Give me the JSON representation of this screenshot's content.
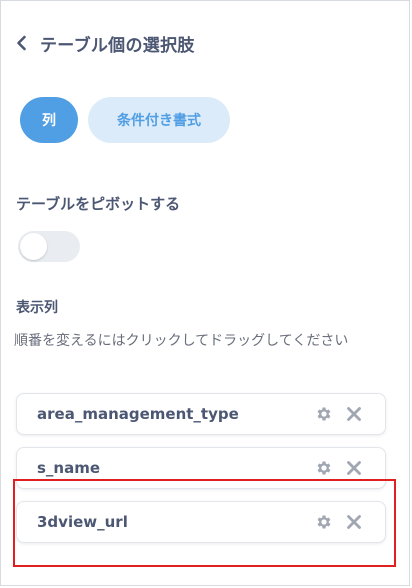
{
  "header": {
    "title": "テーブル個の選択肢",
    "back_icon": "chevron-left-icon"
  },
  "tabs": [
    {
      "label": "列",
      "active": true
    },
    {
      "label": "条件付き書式",
      "active": false
    }
  ],
  "pivot": {
    "label": "テーブルをピボットする",
    "enabled": false
  },
  "columns_section": {
    "label": "表示列",
    "hint": "順番を変えるにはクリックしてドラッグしてください",
    "items": [
      {
        "name": "area_management_type"
      },
      {
        "name": "s_name"
      },
      {
        "name": "3dview_url"
      }
    ]
  },
  "colors": {
    "accent": "#509ee3",
    "accent_light": "#dcebfa",
    "highlight": "#e02020",
    "text": "#4c5773"
  }
}
